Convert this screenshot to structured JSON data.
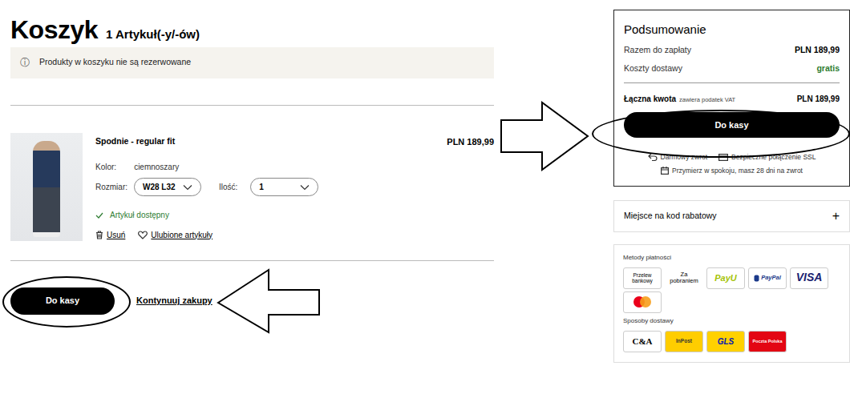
{
  "cart": {
    "title": "Koszyk",
    "count": "1 Artykuł(-y/-ów)",
    "notice_icon": "ⓘ",
    "notice": "Produkty w koszyku nie są rezerwowane",
    "items": [
      {
        "name": "Spodnie - regular fit",
        "price": "PLN 189,99",
        "color_label": "Kolor:",
        "color_value": "ciemnoszary",
        "size_label": "Rozmiar:",
        "size": "W28 L32",
        "qty_label": "Ilość:",
        "qty": "1",
        "availability": "Artykuł dostępny",
        "available": true,
        "remove": "Usuń",
        "favorite": "Ulubione artykuły"
      }
    ],
    "checkout_button": "Do kasy",
    "continue_link": "Kontynuuj zakupy"
  },
  "summary": {
    "title": "Podsumowanie",
    "rows": [
      {
        "label": "Razem do zapłaty",
        "value": "PLN 189,99",
        "kind": "amount"
      },
      {
        "label": "Koszty dostawy",
        "value": "gratis",
        "kind": "free"
      }
    ],
    "total": {
      "label": "Łączna kwota",
      "note": "zawiera podatek VAT",
      "value": "PLN 189,99"
    },
    "checkout_button": "Do kasy",
    "perks": [
      {
        "label": "Darmowy zwrot",
        "kind": "return"
      },
      {
        "label": "Bezpieczne połączenie SSL",
        "kind": "secure"
      },
      {
        "label": "Przymierz w spokoju, masz 28 dni na zwrot",
        "kind": "calendar"
      }
    ]
  },
  "discount": {
    "label": "Miejsce na kod rabatowy",
    "toggle": "+"
  },
  "payment": {
    "title": "Metody płatności",
    "methods": [
      {
        "label": "Przelew bankowy",
        "kind": "text"
      },
      {
        "label": "Za pobraniem",
        "kind": "plain"
      },
      {
        "label": "PayU",
        "kind": "payu"
      },
      {
        "label": "PayPal",
        "kind": "paypal"
      },
      {
        "label": "VISA",
        "kind": "visa"
      },
      {
        "label": "",
        "kind": "mastercard"
      }
    ]
  },
  "delivery": {
    "title": "Sposoby dostawy",
    "methods": [
      {
        "label": "C&A",
        "kind": "ca"
      },
      {
        "label": "InPost",
        "kind": "inpost"
      },
      {
        "label": "GLS",
        "kind": "gls"
      },
      {
        "label": "Poczta Polska",
        "kind": "poczta"
      }
    ]
  }
}
